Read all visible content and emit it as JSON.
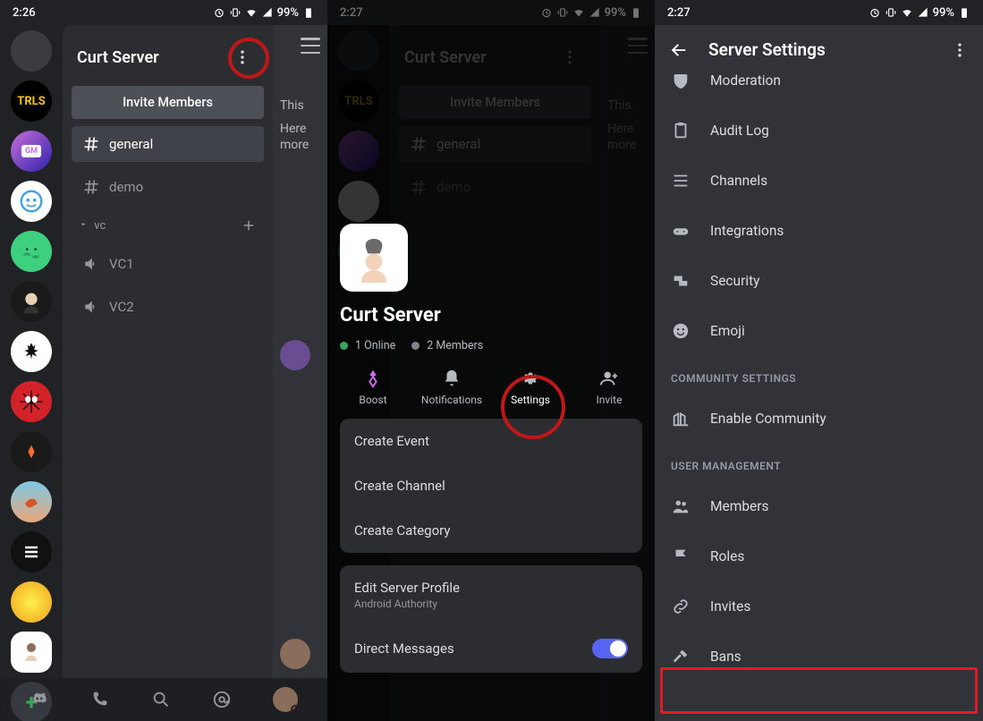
{
  "statusbar": {
    "time1": "2:26",
    "time2": "2:27",
    "time3": "2:27",
    "battery": "99%"
  },
  "panel1": {
    "server_title": "Curt Server",
    "invite_label": "Invite Members",
    "channels": {
      "general": "general",
      "demo": "demo",
      "vc_header": "vc",
      "vc1": "VC1",
      "vc2": "VC2"
    },
    "chat_preview": {
      "line1": "This",
      "line2": "Here",
      "line3": "more"
    }
  },
  "panel2": {
    "bg": {
      "server_title": "Curt Server",
      "invite_label": "Invite Members",
      "general": "general",
      "demo": "demo",
      "prev1": "This",
      "prev2": "Here",
      "prev3": "more"
    },
    "server_name": "Curt Server",
    "online": "1 Online",
    "members": "2 Members",
    "actions": {
      "boost": "Boost",
      "notifications": "Notifications",
      "settings": "Settings",
      "invite": "Invite"
    },
    "menu": {
      "create_event": "Create Event",
      "create_channel": "Create Channel",
      "create_category": "Create Category",
      "edit_profile": "Edit Server Profile",
      "edit_profile_sub": "Android Authority",
      "direct_messages": "Direct Messages"
    }
  },
  "panel3": {
    "title": "Server Settings",
    "items": {
      "moderation": "Moderation",
      "audit_log": "Audit Log",
      "channels": "Channels",
      "integrations": "Integrations",
      "security": "Security",
      "emoji": "Emoji",
      "enable_community": "Enable Community",
      "members": "Members",
      "roles": "Roles",
      "invites": "Invites",
      "bans": "Bans"
    },
    "sections": {
      "community": "COMMUNITY SETTINGS",
      "user_management": "USER MANAGEMENT"
    }
  }
}
